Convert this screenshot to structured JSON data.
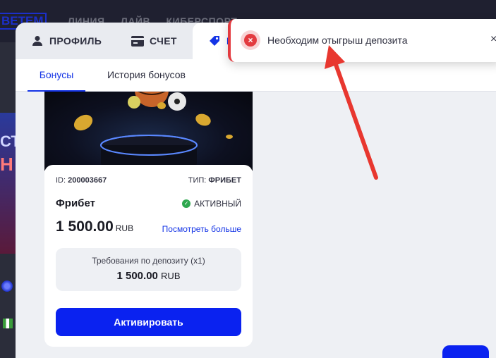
{
  "background": {
    "logo": "BETEM",
    "nav": [
      "ЛИНИЯ",
      "ЛАЙВ",
      "КИБЕРСПОРТ"
    ],
    "banner_text_1": "СТ",
    "banner_text_2": "Н"
  },
  "tabs": [
    {
      "label": "ПРОФИЛЬ",
      "icon": "user-icon"
    },
    {
      "label": "СЧЕТ",
      "icon": "wallet-icon"
    },
    {
      "label": "Б",
      "icon": "tag-icon"
    }
  ],
  "subtabs": [
    {
      "label": "Бонусы",
      "active": true
    },
    {
      "label": "История бонусов",
      "active": false
    }
  ],
  "bonus_card": {
    "id_label": "ID:",
    "id_value": "200003667",
    "type_label": "ТИП:",
    "type_value": "ФРИБЕТ",
    "name": "Фрибет",
    "status": "АКТИВНЫЙ",
    "amount": "1 500.00",
    "currency": "RUB",
    "more_link": "Посмотреть больше",
    "requirement_title": "Требования по депозиту (x1)",
    "requirement_value": "1 500.00",
    "requirement_currency": "RUB",
    "activate_label": "Активировать"
  },
  "toast": {
    "message": "Необходим отыгрыш депозита",
    "close": "×"
  },
  "colors": {
    "accent": "#0a22f0",
    "error": "#e33a3f",
    "success": "#2fa84f",
    "annotation_arrow": "#e8372f"
  }
}
